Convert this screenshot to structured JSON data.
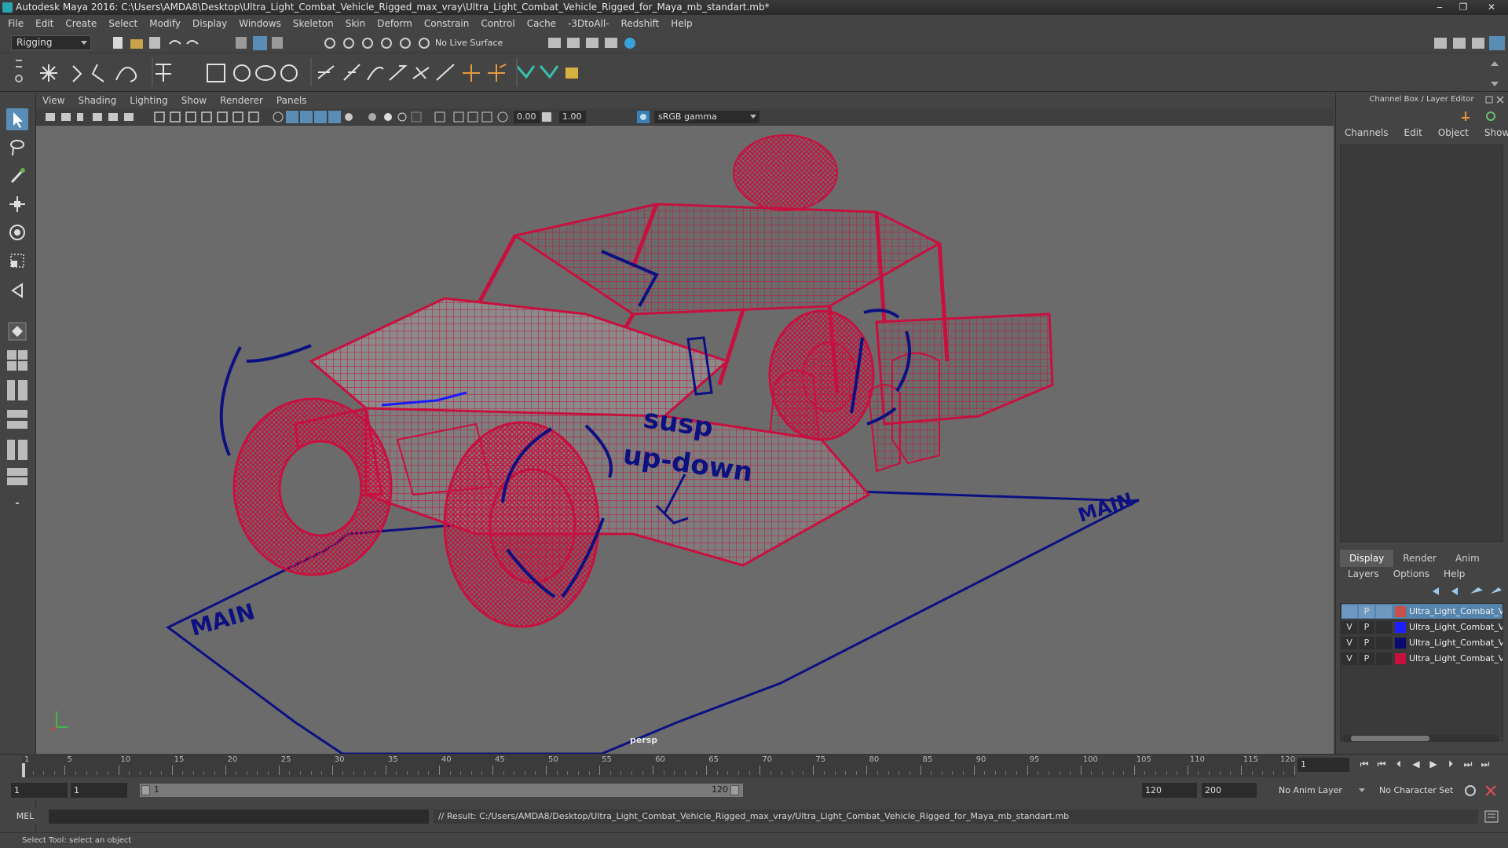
{
  "window": {
    "title": "Autodesk Maya 2016: C:\\Users\\AMDA8\\Desktop\\Ultra_Light_Combat_Vehicle_Rigged_max_vray\\Ultra_Light_Combat_Vehicle_Rigged_for_Maya_mb_standart.mb*",
    "minimize": "‒",
    "maximize": "❐",
    "close": "✕"
  },
  "menubar": [
    "File",
    "Edit",
    "Create",
    "Select",
    "Modify",
    "Display",
    "Windows",
    "Skeleton",
    "Skin",
    "Deform",
    "Constrain",
    "Control",
    "Cache",
    "-3DtoAll-",
    "Redshift",
    "Help"
  ],
  "statusline": {
    "mode": "Rigging",
    "live_surface": "No Live Surface"
  },
  "viewport": {
    "menu": [
      "View",
      "Shading",
      "Lighting",
      "Show",
      "Renderer",
      "Panels"
    ],
    "exposure": "0.00",
    "gamma_value": "1.00",
    "colorspace": "sRGB gamma",
    "camera_label": "persp",
    "rig_labels": {
      "susp": "susp",
      "updown": "up-down",
      "main": "MAIN"
    },
    "colors": {
      "background": "#6b6b6b",
      "wireframe": "#c8103f",
      "rig_controls": "#0d1080"
    }
  },
  "channel_box": {
    "title": "Channel Box / Layer Editor",
    "menu": [
      "Channels",
      "Edit",
      "Object",
      "Show"
    ]
  },
  "layer_editor": {
    "tabs": [
      "Display",
      "Render",
      "Anim"
    ],
    "active_tab": "Display",
    "menu": [
      "Layers",
      "Options",
      "Help"
    ],
    "layers": [
      {
        "v": "",
        "p": "P",
        "color": "#c8504a",
        "name": "Ultra_Light_Combat_Vehicle_Rigged",
        "selected": true
      },
      {
        "v": "V",
        "p": "P",
        "color": "#1e1eff",
        "name": "Ultra_Light_Combat_Vehicle_Rigged",
        "selected": false
      },
      {
        "v": "V",
        "p": "P",
        "color": "#0a0a70",
        "name": "Ultra_Light_Combat_Vehicle_Rigged",
        "selected": false
      },
      {
        "v": "V",
        "p": "P",
        "color": "#c8103f",
        "name": "Ultra_Light_Combat_Vehicle_Rigged",
        "selected": false
      }
    ]
  },
  "timeslider": {
    "ticks": [
      "1",
      "5",
      "10",
      "15",
      "20",
      "25",
      "30",
      "35",
      "40",
      "45",
      "50",
      "55",
      "60",
      "65",
      "70",
      "75",
      "80",
      "85",
      "90",
      "95",
      "100",
      "105",
      "110",
      "115",
      "120"
    ],
    "current_frame": "1",
    "playback": [
      "⏮",
      "⏮",
      "⏴",
      "◀",
      "▶",
      "⏵",
      "⏭",
      "⏭"
    ]
  },
  "rangeline": {
    "start": "1",
    "playback_start": "1",
    "range_start_label": "1",
    "range_end_label": "120",
    "playback_end": "120",
    "end": "200",
    "anim_layer": "No Anim Layer",
    "character_set": "No Character Set"
  },
  "commandline": {
    "mode": "MEL",
    "result": "// Result: C:/Users/AMDA8/Desktop/Ultra_Light_Combat_Vehicle_Rigged_max_vray/Ultra_Light_Combat_Vehicle_Rigged_for_Maya_mb_standart.mb"
  },
  "helpline": {
    "text": "Select Tool: select an object"
  }
}
